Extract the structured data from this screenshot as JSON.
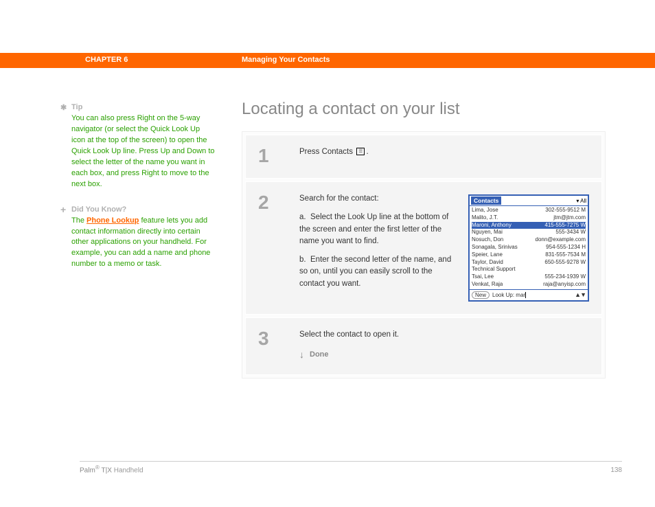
{
  "chapter_bar": {
    "label": "CHAPTER 6",
    "title": "Managing Your Contacts"
  },
  "sidebar": {
    "tip": {
      "heading": "Tip",
      "body": "You can also press Right on the 5-way navigator (or select the Quick Look Up icon at the top of the screen) to open the Quick Look Up line. Press Up and Down to select the letter of the name you want in each box, and press Right to move to the next box."
    },
    "dyk": {
      "heading": "Did You Know?",
      "prefix": "The ",
      "link": "Phone Lookup",
      "suffix": " feature lets you add contact information directly into certain other applications on your handheld. For example, you can add a name and phone number to a memo or task."
    }
  },
  "title": "Locating a contact on your list",
  "steps": {
    "s1": {
      "num": "1",
      "text_pre": "Press Contacts ",
      "text_post": "."
    },
    "s2": {
      "num": "2",
      "intro": "Search for the contact:",
      "a": "Select the Look Up line at the bottom of the screen and enter the first letter of the name you want to find.",
      "b": "Enter the second letter of the name, and so on, until you can easily scroll to the contact you want."
    },
    "s3": {
      "num": "3",
      "text": "Select the contact to open it.",
      "done": "Done"
    }
  },
  "screenshot": {
    "title": "Contacts",
    "dropdown": "▾ All",
    "rows": [
      {
        "name": "Lima, Jose",
        "phone": "302-555-9512 M",
        "sel": false
      },
      {
        "name": "Malito, J.T.",
        "phone": "jtm@jtm.com",
        "sel": false
      },
      {
        "name": "Maroni, Anthony",
        "phone": "415-555-7275 W",
        "sel": true
      },
      {
        "name": "Nguyen, Mai",
        "phone": "555-3434 W",
        "sel": false
      },
      {
        "name": "Nosuch, Don",
        "phone": "donn@example.com",
        "sel": false
      },
      {
        "name": "Sonagala, Srinivas",
        "phone": "954-555-1234 H",
        "sel": false
      },
      {
        "name": "Speier, Lane",
        "phone": "831-555-7534 M",
        "sel": false
      },
      {
        "name": "Taylor, David",
        "phone": "650-555-9278 W",
        "sel": false
      },
      {
        "name": "Technical Support",
        "phone": "",
        "sel": false
      },
      {
        "name": "Tsai, Lee",
        "phone": "555-234-1939 W",
        "sel": false
      },
      {
        "name": "Venkat, Raja",
        "phone": "raja@anyisp.com",
        "sel": false
      }
    ],
    "new_btn": "New",
    "lookup_label": "Look Up:",
    "lookup_value": "mar"
  },
  "footer": {
    "brand_pre": "Palm",
    "brand_mid": "T|X",
    "brand_post": " Handheld",
    "page": "138"
  }
}
